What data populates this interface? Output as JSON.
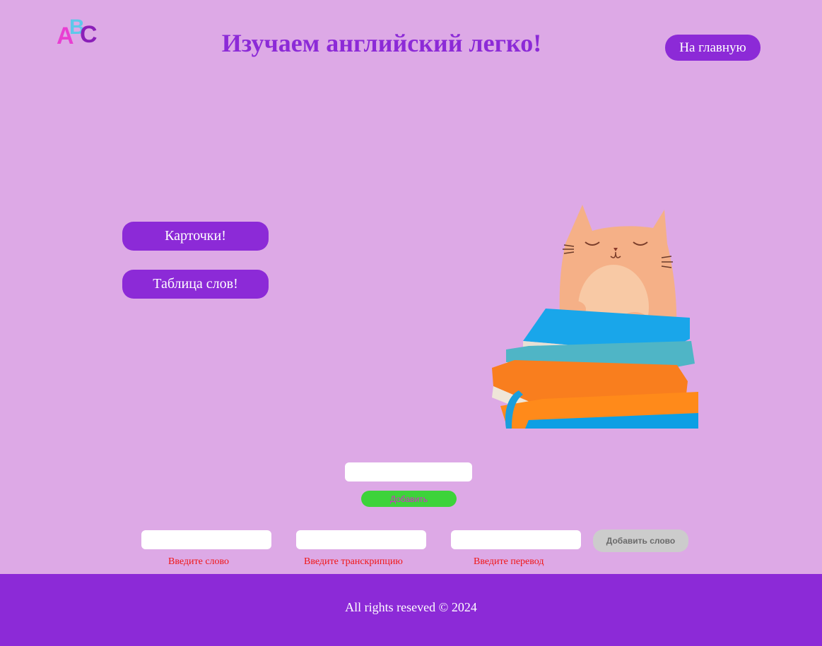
{
  "header": {
    "logo_letters": [
      "A",
      "B",
      "C"
    ],
    "title": "Изучаем английский легко!",
    "home_button": "На главную"
  },
  "nav": {
    "cards_button": "Карточки!",
    "table_button": "Таблица слов!"
  },
  "illustration": {
    "icon": "cat-on-books-icon"
  },
  "quick_add": {
    "input_value": "",
    "button_label": "Добавить"
  },
  "word_form": {
    "word_value": "",
    "transcription_value": "",
    "translation_value": "",
    "submit_label": "Добавить слово",
    "word_hint": "Введите слово",
    "transcription_hint": "Введите транскрипцию",
    "translation_hint": "Введите перевод"
  },
  "footer": {
    "text": "All rights reseved © 2024"
  },
  "colors": {
    "background": "#dda9e6",
    "accent": "#8c2ad7",
    "add_button": "#3dd33a",
    "hint_text": "#f01616",
    "disabled_button": "#cccccc"
  }
}
